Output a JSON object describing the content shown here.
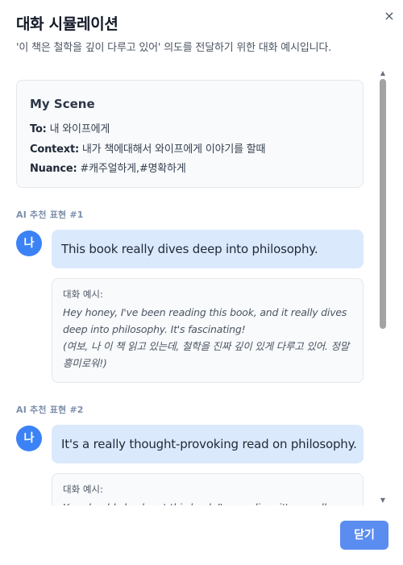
{
  "header": {
    "title": "대화 시뮬레이션",
    "subtitle": "'이 책은 철학을 깊이 다루고 있어' 의도를 전달하기 위한 대화 예시입니다.",
    "close_icon": "×"
  },
  "scene": {
    "title": "My Scene",
    "to_label": "To:",
    "to_value": " 내 와이프에게",
    "context_label": "Context:",
    "context_value": " 내가 책에대해서 와이프에게 이야기를 할때",
    "nuance_label": "Nuance:",
    "nuance_value": " #캐주얼하게,#명확하게"
  },
  "suggestions": [
    {
      "label": "AI 추천 표현 #1",
      "avatar": "나",
      "expression": "This book really dives deep into philosophy.",
      "example_label": "대화 예시:",
      "example_en": "Hey honey, I've been reading this book, and it really dives deep into philosophy. It's fascinating!",
      "example_ko": "(여보, 나 이 책 읽고 있는데, 철학을 진짜 깊이 있게 다루고 있어. 정말 흥미로워!)"
    },
    {
      "label": "AI 추천 표현 #2",
      "avatar": "나",
      "expression": "It's a really thought-provoking read on philosophy.",
      "example_label": "대화 예시:",
      "example_en": "You should check out this book I'm reading; it's a really"
    }
  ],
  "scrollbar": {
    "up_icon": "▲",
    "down_icon": "▼",
    "thumb_fraction": 0.6
  },
  "footer": {
    "close_button": "닫기"
  },
  "colors": {
    "accent": "#3b82f6",
    "button": "#5b8cf0",
    "bubble": "#dbe9fd",
    "label": "#7d8fab"
  }
}
